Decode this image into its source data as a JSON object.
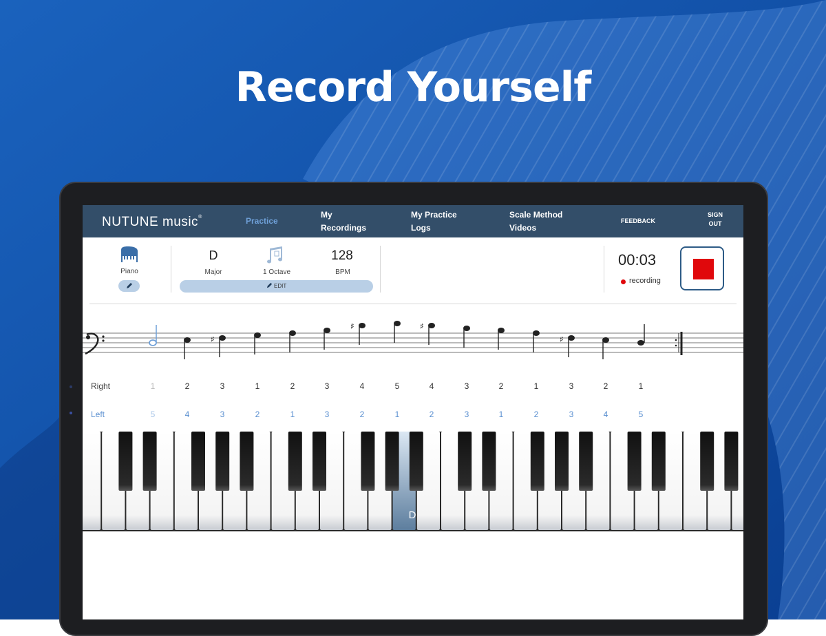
{
  "headline": "Record Yourself",
  "colors": {
    "background": "#0d4fa8",
    "nav": "#334e69",
    "accent": "#6fa0d8",
    "record": "#e0080c"
  },
  "app": {
    "logo": "NUTUNE music",
    "logo_mark": "®",
    "nav": [
      {
        "label": "Practice",
        "active": true
      },
      {
        "label": "My Recordings"
      },
      {
        "label": "My Practice Logs"
      },
      {
        "label": "Scale Method Videos"
      },
      {
        "label": "FEEDBACK"
      },
      {
        "label": "SIGN OUT"
      }
    ]
  },
  "controls": {
    "instrument_label": "Piano",
    "instrument_icon": "grand-piano-icon",
    "key_value": "D",
    "key_label": "Major",
    "range_icon": "musical-notes-icon",
    "range_label": "1 Octave",
    "tempo_value": "128",
    "tempo_label": "BPM",
    "edit_label": "EDIT",
    "timer": "00:03",
    "status": "recording",
    "stop_icon": "stop-icon"
  },
  "fingering": {
    "right_label": "Right",
    "left_label": "Left",
    "right": [
      "1",
      "2",
      "3",
      "1",
      "2",
      "3",
      "4",
      "5",
      "4",
      "3",
      "2",
      "1",
      "3",
      "2",
      "1"
    ],
    "left": [
      "5",
      "4",
      "3",
      "2",
      "1",
      "3",
      "2",
      "1",
      "2",
      "3",
      "1",
      "2",
      "3",
      "4",
      "5"
    ]
  },
  "keyboard": {
    "highlighted_key_label": "D"
  }
}
